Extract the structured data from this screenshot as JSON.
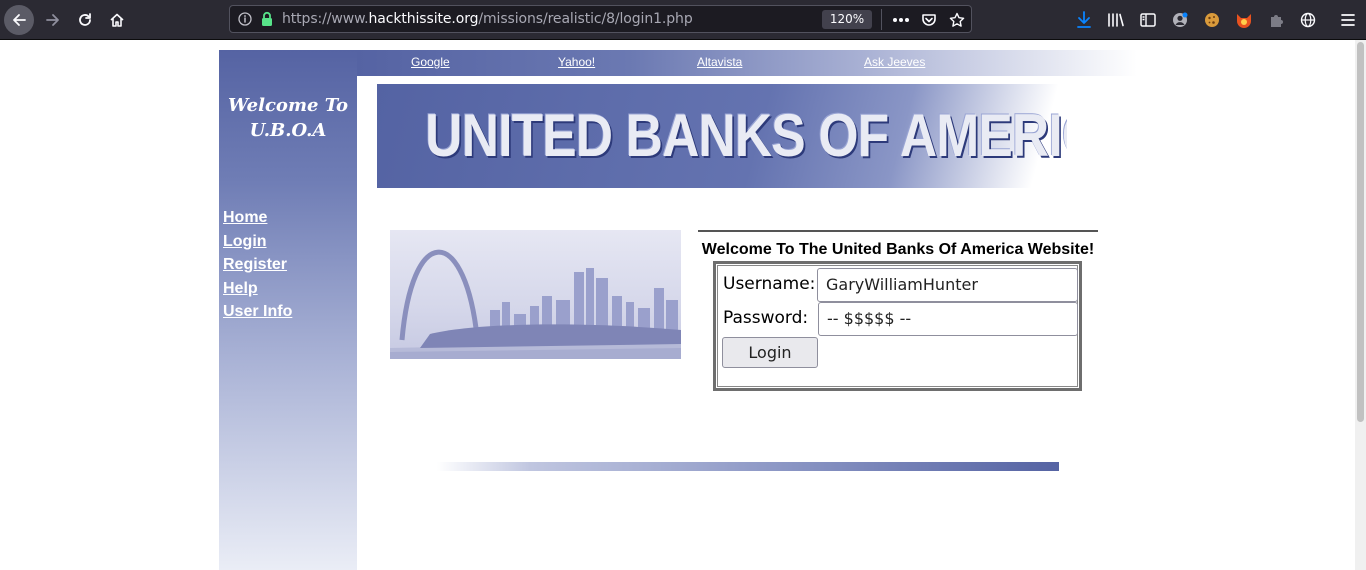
{
  "browser": {
    "url_prefix": "https://www.",
    "url_domain": "hackthissite.org",
    "url_path": "/missions/realistic/8/login1.php",
    "zoom": "120%",
    "accent": "#0a84ff"
  },
  "sidebar": {
    "welcome_line1": "Welcome To",
    "welcome_line2": "U.B.O.A",
    "links": [
      "Home",
      "Login",
      "Register",
      "Help",
      "User Info"
    ]
  },
  "topnav": {
    "links": [
      "Google",
      "Yahoo!",
      "Altavista",
      "Ask Jeeves"
    ]
  },
  "banner": {
    "text": "UNITED BANKS OF AMERICA"
  },
  "login": {
    "welcome_text": "Welcome To The United Banks Of America Website!",
    "username_label": "Username:",
    "username_value": "GaryWilliamHunter",
    "password_label": "Password:",
    "password_value": "-- $$$$$ --",
    "button_label": "Login"
  },
  "colors": {
    "brand_blue": "#5563a3",
    "link_white": "#ffffff"
  }
}
